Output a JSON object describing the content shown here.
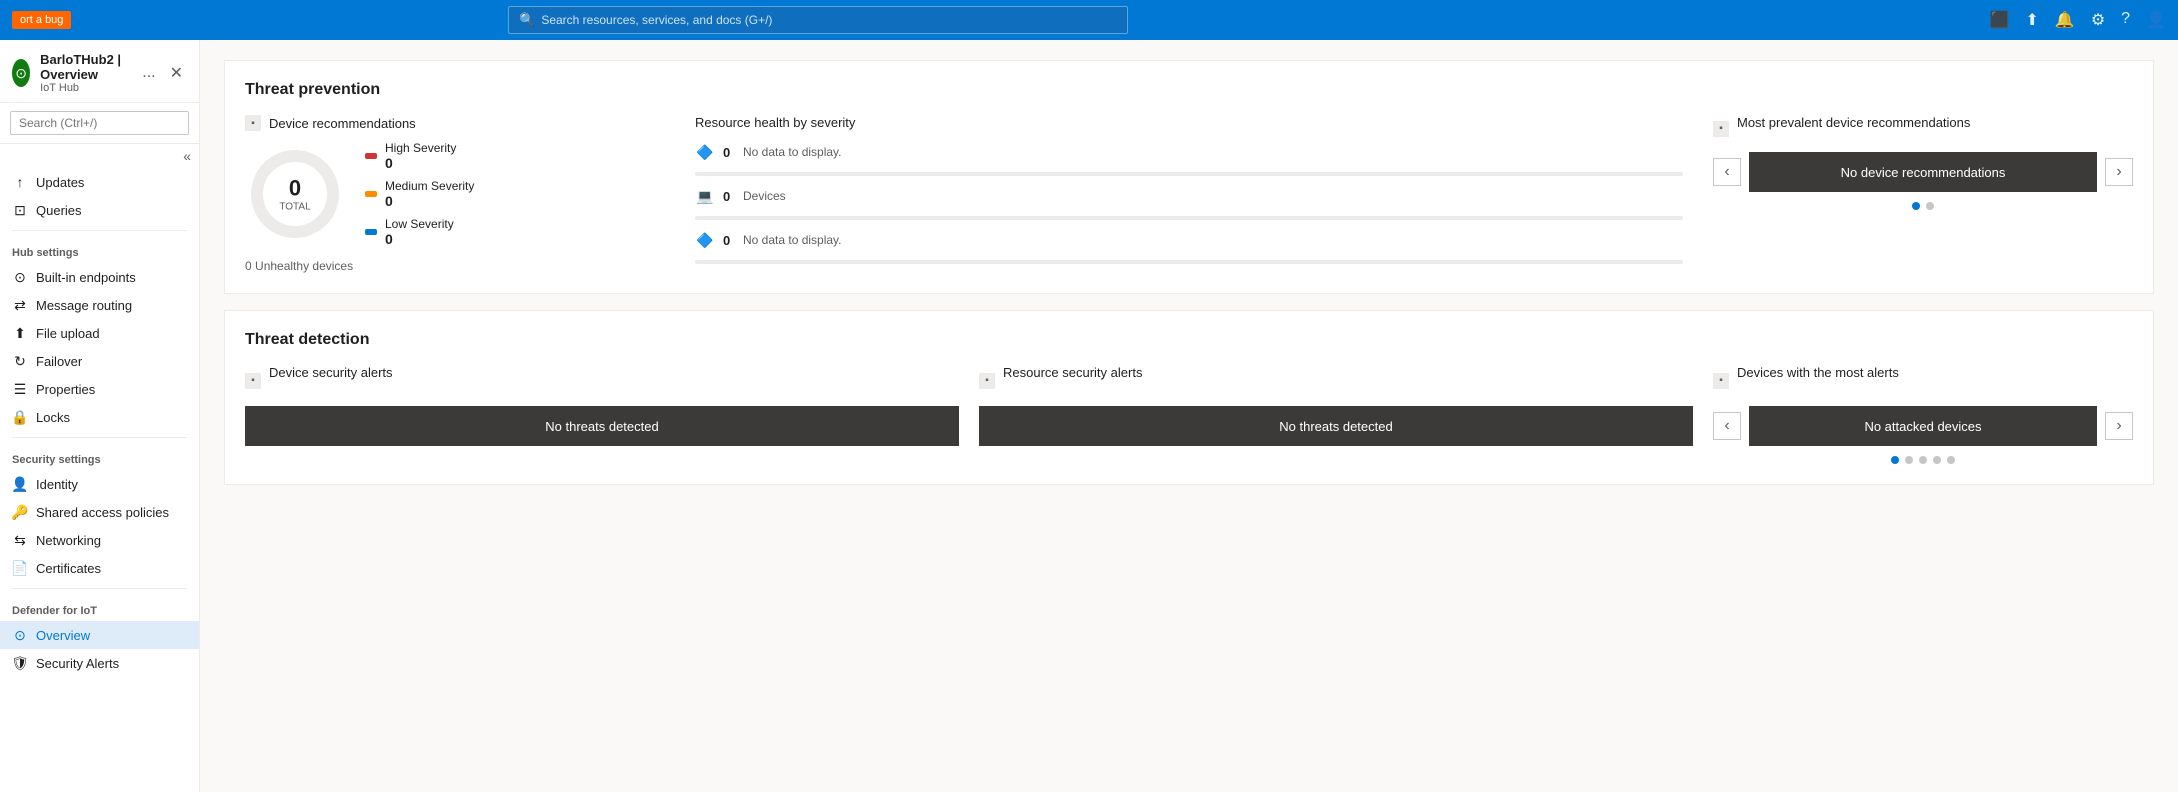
{
  "topbar": {
    "report_bug": "ort a bug",
    "search_placeholder": "Search resources, services, and docs (G+/)"
  },
  "sidebar": {
    "hub_name": "BarloTHub2 | Overview",
    "hub_subtitle": "IoT Hub",
    "hub_more": "...",
    "search_placeholder": "Search (Ctrl+/)",
    "collapse_icon": "«",
    "sections": [
      {
        "label": null,
        "items": [
          {
            "id": "updates",
            "label": "Updates",
            "icon": "↑"
          },
          {
            "id": "queries",
            "label": "Queries",
            "icon": "⊡"
          }
        ]
      },
      {
        "label": "Hub settings",
        "items": [
          {
            "id": "built-in-endpoints",
            "label": "Built-in endpoints",
            "icon": "⊙"
          },
          {
            "id": "message-routing",
            "label": "Message routing",
            "icon": "⇄"
          },
          {
            "id": "file-upload",
            "label": "File upload",
            "icon": "⬆"
          },
          {
            "id": "failover",
            "label": "Failover",
            "icon": "↻"
          },
          {
            "id": "properties",
            "label": "Properties",
            "icon": "☰"
          },
          {
            "id": "locks",
            "label": "Locks",
            "icon": "🔒"
          }
        ]
      },
      {
        "label": "Security settings",
        "items": [
          {
            "id": "identity",
            "label": "Identity",
            "icon": "👤"
          },
          {
            "id": "shared-access",
            "label": "Shared access policies",
            "icon": "🔑"
          },
          {
            "id": "networking",
            "label": "Networking",
            "icon": "⇆"
          },
          {
            "id": "certificates",
            "label": "Certificates",
            "icon": "📄"
          }
        ]
      },
      {
        "label": "Defender for IoT",
        "items": [
          {
            "id": "overview",
            "label": "Overview",
            "icon": "⊙",
            "active": true
          },
          {
            "id": "security-alerts",
            "label": "Security Alerts",
            "icon": "🛡"
          }
        ]
      }
    ]
  },
  "main": {
    "threat_prevention": {
      "title": "Threat prevention",
      "device_recommendations": {
        "title": "Device recommendations",
        "total": 0,
        "total_label": "TOTAL",
        "unhealthy_count": 0,
        "unhealthy_label": "Unhealthy devices",
        "severity": [
          {
            "label": "High Severity",
            "count": 0,
            "color": "#d13438"
          },
          {
            "label": "Medium Severity",
            "count": 0,
            "color": "#ff8c00"
          },
          {
            "label": "Low Severity",
            "count": 0,
            "color": "#0078d4"
          }
        ]
      },
      "resource_health": {
        "title": "Resource health by severity",
        "rows": [
          {
            "icon": "🔷",
            "count": 0,
            "label": "No data to display."
          },
          {
            "icon": "💻",
            "count": 0,
            "label": "Devices"
          },
          {
            "icon": "🔷",
            "count": 0,
            "label": "No data to display."
          }
        ]
      },
      "most_prevalent": {
        "title": "Most prevalent device recommendations",
        "content": "No device recommendations",
        "dots": [
          true,
          false
        ]
      }
    },
    "threat_detection": {
      "title": "Threat detection",
      "device_security_alerts": {
        "title": "Device security alerts",
        "content": "No threats detected"
      },
      "resource_security_alerts": {
        "title": "Resource security alerts",
        "content": "No threats detected"
      },
      "devices_with_most_alerts": {
        "title": "Devices with the most alerts",
        "content": "No attacked devices",
        "dots": [
          true,
          false,
          false,
          false,
          false
        ]
      }
    }
  },
  "icons": {
    "search": "🔍",
    "close": "✕",
    "chevron_left": "‹",
    "chevron_right": "›",
    "collapse": "«",
    "monitor": "🖥",
    "settings": "⚙",
    "bell": "🔔",
    "question": "?",
    "feedback": "💬",
    "screenshot": "📷",
    "upload": "⬆"
  }
}
